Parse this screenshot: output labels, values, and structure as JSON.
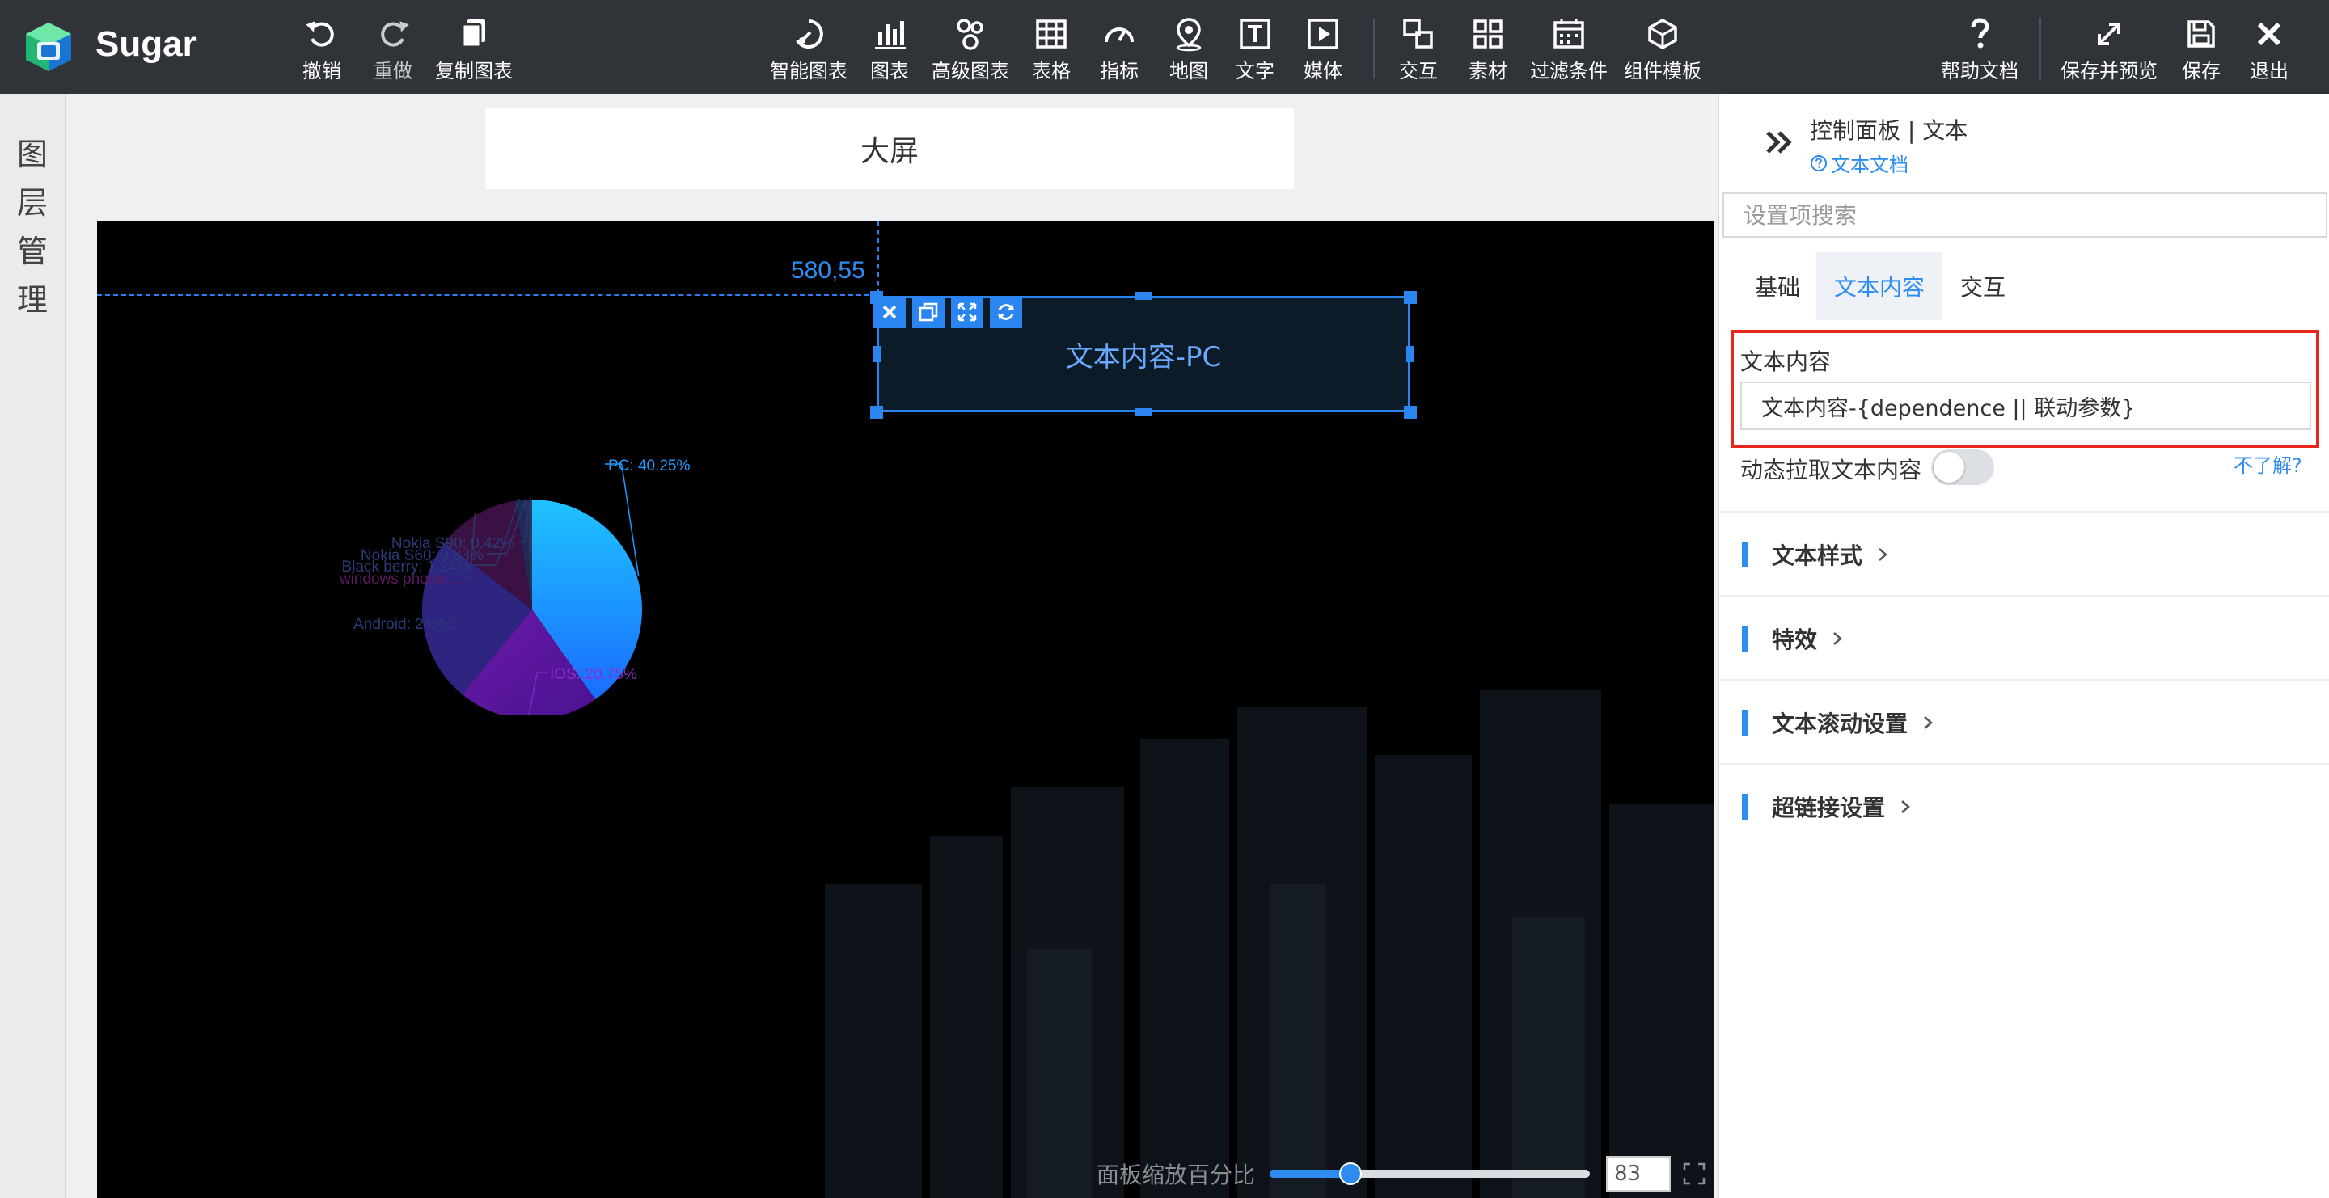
{
  "app": {
    "title": "Sugar"
  },
  "toolbar": {
    "undo": "撤销",
    "redo": "重做",
    "copy_chart": "复制图表",
    "items": [
      {
        "key": "smart-chart",
        "label": "智能图表",
        "icon": "smart-chart-icon"
      },
      {
        "key": "chart",
        "label": "图表",
        "icon": "bar-chart-icon"
      },
      {
        "key": "advanced-chart",
        "label": "高级图表",
        "icon": "advanced-chart-icon"
      },
      {
        "key": "table",
        "label": "表格",
        "icon": "table-icon"
      },
      {
        "key": "indicator",
        "label": "指标",
        "icon": "gauge-icon"
      },
      {
        "key": "map",
        "label": "地图",
        "icon": "map-pin-icon"
      },
      {
        "key": "text",
        "label": "文字",
        "icon": "text-icon"
      },
      {
        "key": "media",
        "label": "媒体",
        "icon": "media-play-icon"
      },
      {
        "key": "interaction",
        "label": "交互",
        "icon": "interaction-icon"
      },
      {
        "key": "material",
        "label": "素材",
        "icon": "grid-icon"
      },
      {
        "key": "filter",
        "label": "过滤条件",
        "icon": "calendar-icon"
      },
      {
        "key": "template",
        "label": "组件模板",
        "icon": "cube-icon"
      }
    ],
    "help": "帮助文档",
    "save_preview": "保存并预览",
    "save": "保存",
    "exit": "退出"
  },
  "left_rail": {
    "chars": [
      "图",
      "层",
      "管",
      "理"
    ]
  },
  "canvas": {
    "screen_title": "大屏",
    "coordinates": "580,55",
    "text_component_content": "文本内容-PC",
    "zoom_label": "面板缩放百分比",
    "zoom_value": 83
  },
  "chart_data": {
    "type": "pie",
    "labels": [
      "PC: 40.25%",
      "IOS: 20.75%",
      "Android: 24.4...",
      "windows phone:...",
      "Black berry: 1.24%",
      "Nokia S60: 0.83%",
      "Nokia S90: 0.42%"
    ],
    "values": [
      40.25,
      20.75,
      24.4,
      12.11,
      1.24,
      0.83,
      0.42
    ],
    "colors": [
      "#1e9bff",
      "#5c1aa0",
      "#2d2580",
      "#3b1042",
      "#1f2a5a",
      "#23305c",
      "#2a3c66"
    ]
  },
  "panel": {
    "title": "控制面板 | 文本",
    "doc_link": "文本文档",
    "search_placeholder": "设置项搜索",
    "tabs": [
      "基础",
      "文本内容",
      "交互"
    ],
    "text_content_label": "文本内容",
    "text_content_value": "文本内容-{dependence || 联动参数}",
    "dynamic_label": "动态拉取文本内容",
    "help_link": "不了解?",
    "sections": [
      "文本样式",
      "特效",
      "文本滚动设置",
      "超链接设置"
    ]
  }
}
